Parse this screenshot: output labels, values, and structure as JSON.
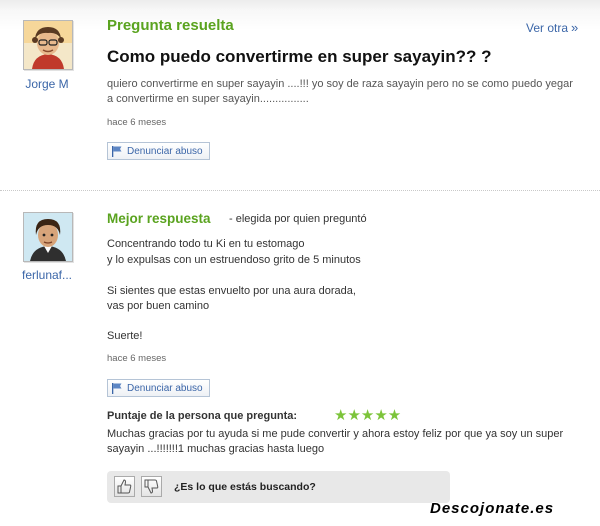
{
  "question": {
    "status": "Pregunta resuelta",
    "see_more": "Ver otra",
    "see_more_arrow": "»",
    "title": "Como puedo convertirme en super sayayin?? ?",
    "body": "quiero convertirme en super sayayin ....!!! yo soy de raza sayayin pero no se como puedo yegar a convertirme en super sayayin................",
    "time": "hace 6 meses",
    "report_label": "Denunciar abuso",
    "author": "Jorge M"
  },
  "answer": {
    "author": "ferlunaf...",
    "label": "Mejor respuesta",
    "sublabel": "- elegida por quien preguntó",
    "lines": [
      "Concentrando todo tu Ki en tu estomago",
      "y lo expulsas con un estruendoso grito de 5 minutos",
      "Si sientes que estas envuelto por una aura dorada,",
      "vas por buen camino",
      "Suerte!"
    ],
    "time": "hace 6 meses",
    "report_label": "Denunciar abuso",
    "rating_label": "Puntaje de la persona que pregunta:",
    "rating_stars": "★★★★★",
    "rating_value": 5,
    "rating_comment": "Muchas gracias por tu ayuda si me pude convertir y ahora estoy feliz por que ya soy un super sayayin ...!!!!!!!1 muchas gracias hasta luego"
  },
  "feedback": {
    "question": "¿Es lo que estás buscando?",
    "thumbs_up_icon": "thumbs-up-icon",
    "thumbs_down_icon": "thumbs-down-icon"
  },
  "watermark": "Descojonate.es",
  "colors": {
    "accent_green": "#5aa31f",
    "link_blue": "#3b66a8",
    "star_green": "#7cc43a"
  }
}
